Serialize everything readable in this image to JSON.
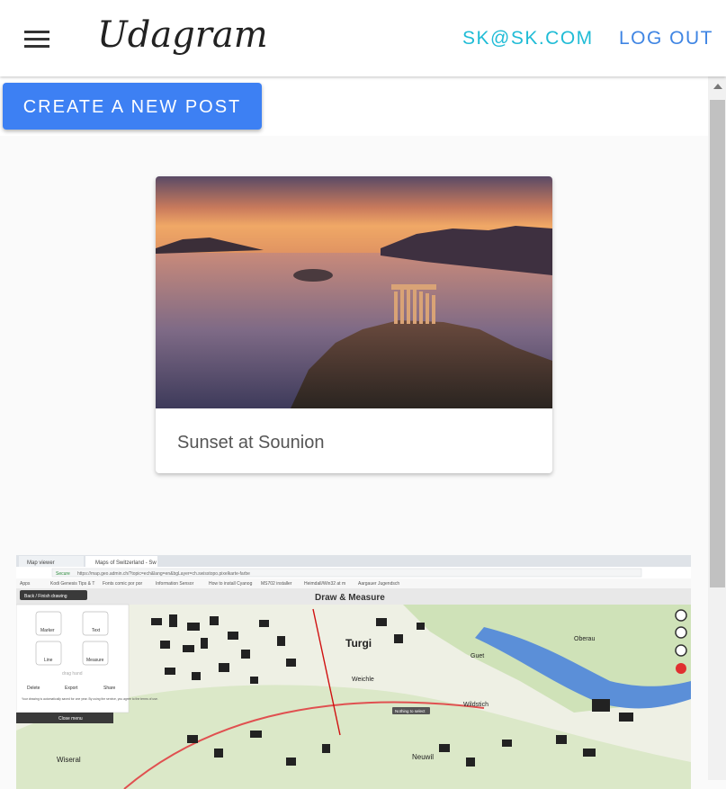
{
  "header": {
    "brand": "Udagram",
    "user_email": "SK@SK.COM",
    "logout_label": "LOG OUT"
  },
  "actions": {
    "create_post_label": "CREATE A NEW POST"
  },
  "feed": {
    "posts": [
      {
        "caption": "Sunset at Sounion"
      }
    ]
  },
  "screenshot_post": {
    "tabs": [
      "Map viewer",
      "Maps of Switzerland - Sw"
    ],
    "address": "https://map.geo.admin.ch/?topic=ech&lang=en&bgLayer=ch.swisstopo.pixelkarte-farbe",
    "secure_label": "Secure",
    "bookmarks": [
      "Apps",
      "Kodi Genesis Tips & T",
      "Fonts comic por por",
      "Information Sensor",
      "How to install Cyanog",
      "MS702 installer",
      "Heimdall/Win32 at m",
      "Aargauer Jugendsch"
    ],
    "back_button": "Back / Finish drawing",
    "panel_title": "Draw & Measure",
    "tools": [
      "Marker",
      "Text",
      "Line",
      "Measure"
    ],
    "drag_hint": "drag hand",
    "panel_actions": [
      "Delete",
      "Export",
      "Share"
    ],
    "notice": "Your drawing is automatically saved for one year. By using the service, you agree to the terms of use.",
    "close_menu": "Close menu",
    "map_labels": [
      "Turgi",
      "Weichle",
      "Guet",
      "Oberau",
      "Wildstich",
      "Neuwil",
      "Wiseral",
      "Nothing to select"
    ]
  }
}
